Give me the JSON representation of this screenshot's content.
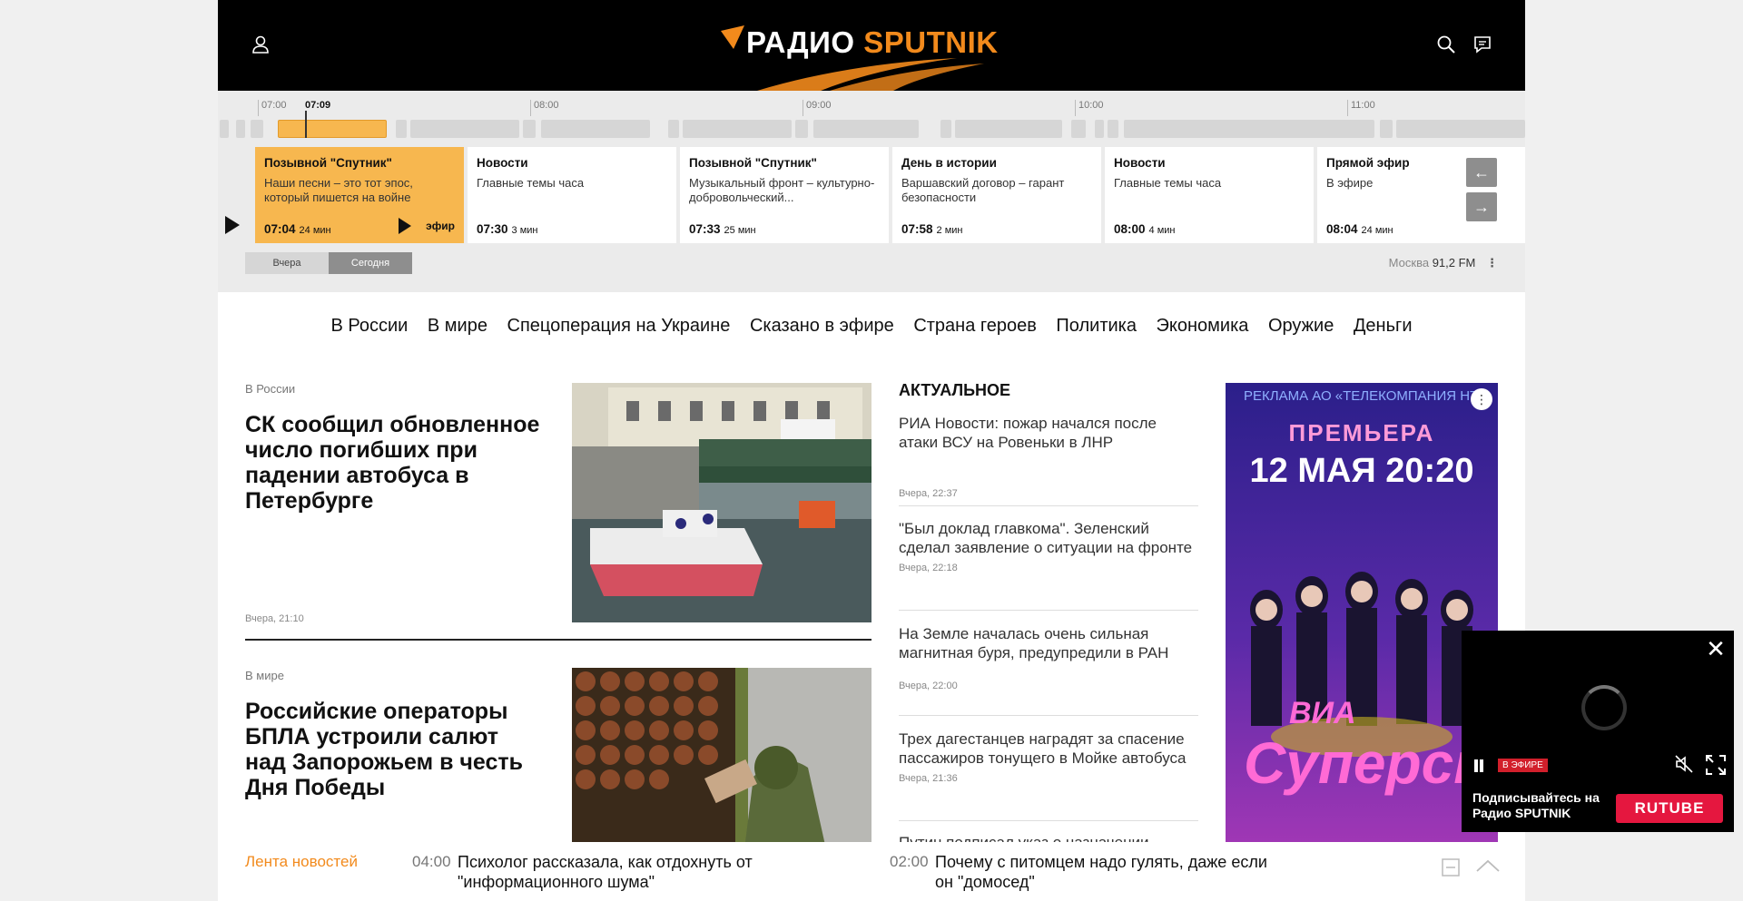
{
  "header": {
    "logo_radio": "РАДИО",
    "logo_sputnik": "SPUTNIK"
  },
  "timeline": {
    "ticks": [
      "07:00",
      "08:00",
      "09:00",
      "10:00",
      "11:00"
    ],
    "current_time": "07:09",
    "cards": [
      {
        "title": "Позывной \"Спутник\"",
        "desc": "Наши песни – это тот эпос, который пишется на войне",
        "time": "07:04",
        "dur": "24 мин",
        "live": "эфир"
      },
      {
        "title": "Новости",
        "desc": "Главные темы часа",
        "time": "07:30",
        "dur": "3 мин"
      },
      {
        "title": "Позывной \"Спутник\"",
        "desc": "Музыкальный фронт – культурно-добровольческий...",
        "time": "07:33",
        "dur": "25 мин"
      },
      {
        "title": "День в истории",
        "desc": "Варшавский договор – гарант безопасности",
        "time": "07:58",
        "dur": "2 мин"
      },
      {
        "title": "Новости",
        "desc": "Главные темы часа",
        "time": "08:00",
        "dur": "4 мин"
      },
      {
        "title": "Прямой эфир",
        "desc": "В эфире",
        "time": "08:04",
        "dur": "24 мин"
      }
    ],
    "day_yesterday": "Вчера",
    "day_today": "Сегодня",
    "station_city": "Москва",
    "station_freq": "91,2 FM"
  },
  "nav": [
    "В России",
    "В мире",
    "Спецоперация на Украине",
    "Сказано в эфире",
    "Страна героев",
    "Политика",
    "Экономика",
    "Оружие",
    "Деньги"
  ],
  "articles": [
    {
      "category": "В России",
      "title": "СК сообщил обновленное число погибших при падении автобуса в Петербурге",
      "date": "Вчера, 21:10"
    },
    {
      "category": "В мире",
      "title": "Российские операторы БПЛА устроили салют над Запорожьем в честь Дня Победы",
      "date": ""
    }
  ],
  "actual": {
    "heading": "АКТУАЛЬНОЕ",
    "items": [
      {
        "text": "РИА Новости: пожар начался после атаки ВСУ на Ровеньки в ЛНР",
        "date": "Вчера, 22:37"
      },
      {
        "text": "\"Был доклад главкома\". Зеленский сделал заявление о ситуации на фронте",
        "date": "Вчера, 22:18"
      },
      {
        "text": "На Земле началась очень сильная магнитная буря, предупредили в РАН",
        "date": "Вчера, 22:00"
      },
      {
        "text": "Трех дагестанцев наградят за спасение пассажиров тонущего в Мойке автобуса",
        "date": "Вчера, 21:36"
      },
      {
        "text": "Путин подписал указ о назначении",
        "date": ""
      }
    ]
  },
  "ad": {
    "top": "РЕКЛАМА АО «ТЕЛЕКОМПАНИЯ НТВ",
    "premiere": "ПРЕМЬЕРА",
    "date": "12 МАЯ 20:20",
    "via": "ВИА",
    "title": "Суперстар!"
  },
  "ticker": {
    "label": "Лента новостей",
    "items": [
      {
        "time": "04:00",
        "text": "Психолог рассказала, как отдохнуть от \"информационного шума\""
      },
      {
        "time": "02:00",
        "text": "Почему с питомцем надо гулять, даже если он \"домосед\""
      }
    ]
  },
  "video": {
    "live": "В ЭФИРЕ",
    "subscribe": "Подписывайтесь на Радио SPUTNIK",
    "rutube": "RUTUBE"
  },
  "colors": {
    "accent": "#f28a1c",
    "active_card": "#f7b74f",
    "header_bg": "#000000",
    "rutube": "#e5173f",
    "live_badge": "#d21f2b"
  }
}
